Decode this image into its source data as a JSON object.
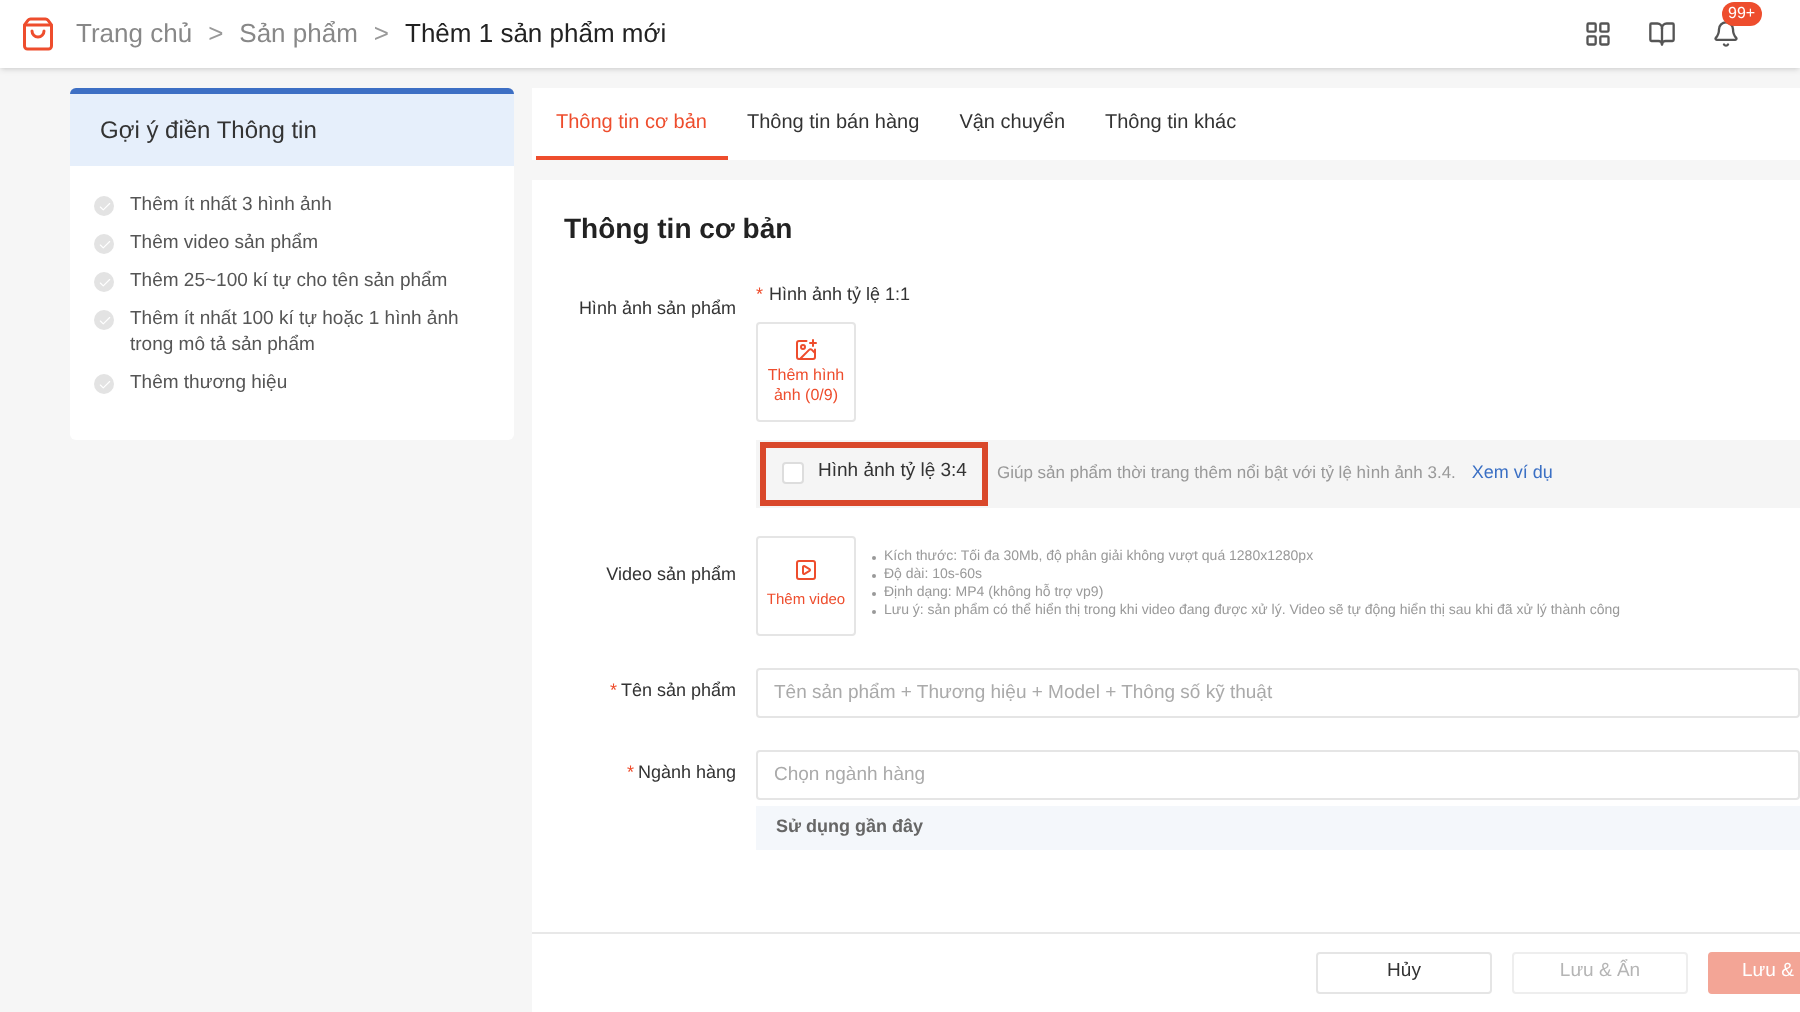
{
  "breadcrumb": [
    {
      "label": "Trang chủ",
      "current": false
    },
    {
      "label": "Sản phẩm",
      "current": false
    },
    {
      "label": "Thêm 1 sản phẩm mới",
      "current": true
    }
  ],
  "separator": ">",
  "notifications": {
    "badge": "99+"
  },
  "suggestions": {
    "title": "Gợi ý điền Thông tin",
    "items": [
      {
        "text": "Thêm ít nhất 3 hình ảnh",
        "done": false
      },
      {
        "text": "Thêm video sản phẩm",
        "done": false
      },
      {
        "text": "Thêm 25~100 kí tự cho tên sản phẩm",
        "done": false
      },
      {
        "text": "Thêm ít nhất 100 kí tự hoặc 1 hình ảnh trong mô tả sản phẩm",
        "done": false
      },
      {
        "text": "Thêm thương hiệu",
        "done": false
      }
    ]
  },
  "tabs": [
    {
      "label": "Thông tin cơ bản",
      "selected": true
    },
    {
      "label": "Thông tin bán hàng",
      "selected": false
    },
    {
      "label": "Vận chuyển",
      "selected": false
    },
    {
      "label": "Thông tin khác",
      "selected": false
    }
  ],
  "section_title": "Thông tin cơ bản",
  "images": {
    "label": "Hình ảnh sản phẩm",
    "ratio_mark": "*",
    "ratio_label": "Hình ảnh tỷ lệ 1:1",
    "upload": "Thêm hình ảnh (0/9)",
    "option": {
      "label": "Hình ảnh tỷ lệ 3:4",
      "checked": false,
      "help": "Giúp sản phẩm thời trang thêm nổi bật với tỷ lệ hình ảnh 3.4.",
      "link": "Xem ví dụ"
    }
  },
  "video": {
    "label": "Video sản phẩm",
    "upload": "Thêm video",
    "notes": [
      "Kích thước: Tối đa 30Mb, độ phân giải không vượt quá 1280x1280px",
      "Độ dài: 10s-60s",
      "Định dạng: MP4 (không hỗ trợ vp9)",
      "Lưu ý: sản phẩm có thể hiển thị trong khi video đang được xử lý. Video sẽ tự động hiển thị sau khi đã xử lý thành công"
    ]
  },
  "name_field": {
    "label": "Tên sản phẩm",
    "required_mark": "*",
    "placeholder": "Tên sản phẩm + Thương hiệu + Model + Thông số kỹ thuật"
  },
  "category_field": {
    "label": "Ngành hàng",
    "required_mark": "*",
    "placeholder": "Chọn ngành hàng",
    "recent": "Sử dụng gần đây"
  },
  "buttons": [
    {
      "label": "Hủy",
      "kind": "default",
      "disabled": false
    },
    {
      "label": "Lưu & Ẩn",
      "kind": "default",
      "disabled": true
    },
    {
      "label": "Lưu &",
      "kind": "primary",
      "disabled": true
    }
  ]
}
